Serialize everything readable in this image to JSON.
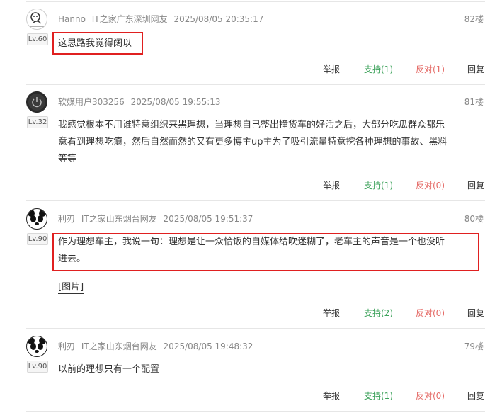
{
  "actions": {
    "report": "举报",
    "reply": "回复"
  },
  "comments": [
    {
      "user": "Hanno",
      "location": "IT之家广东深圳网友",
      "time": "2025/08/05 20:35:17",
      "floor": "82楼",
      "level": "Lv.60",
      "text": "这思路我觉得阔以",
      "support": "支持(1)",
      "oppose": "反对(1)"
    },
    {
      "user": "软媒用户303256",
      "location": "",
      "time": "2025/08/05 19:55:13",
      "floor": "81楼",
      "level": "Lv.32",
      "text_lines": [
        "我感觉根本不用谁特意组织来黑理想，当理想自己整出撞货车的好活之后，大部分吃瓜群众都乐",
        "意看到理想吃瘪，然后自然而然的又有更多博主up主为了吸引流量特意挖各种理想的事故、黑料",
        "等等"
      ],
      "support": "支持(1)",
      "oppose": "反对(0)"
    },
    {
      "user": "利刃",
      "location": "IT之家山东烟台网友",
      "time": "2025/08/05 19:51:37",
      "floor": "80楼",
      "level": "Lv.90",
      "text_lines": [
        "作为理想车主，我说一句：理想是让一众恰饭的自媒体给吹迷糊了，老车主的声音是一个也没听",
        "进去。"
      ],
      "image_link": "[图片]",
      "support": "支持(2)",
      "oppose": "反对(0)"
    },
    {
      "user": "利刃",
      "location": "IT之家山东烟台网友",
      "time": "2025/08/05 19:48:32",
      "floor": "79楼",
      "level": "Lv.90",
      "text": "以前的理想只有一个配置",
      "support": "支持(1)",
      "oppose": "反对(0)"
    }
  ]
}
